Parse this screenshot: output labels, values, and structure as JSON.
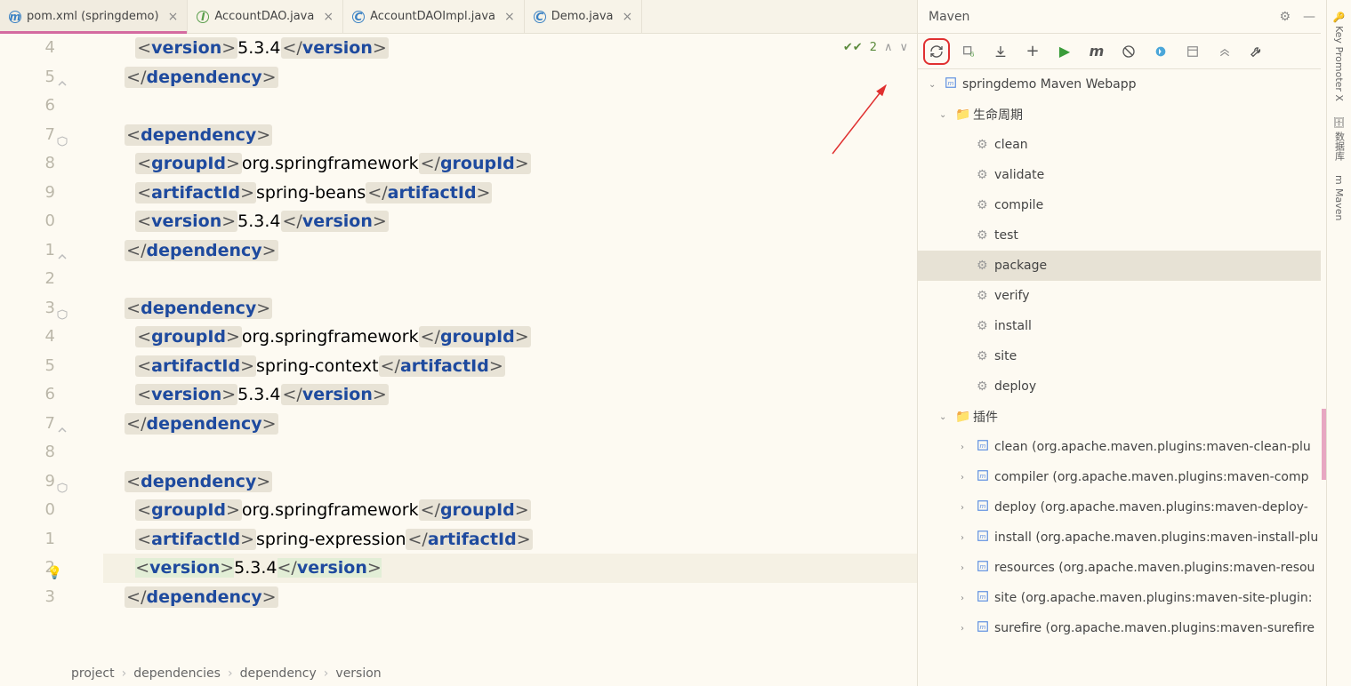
{
  "tabs": [
    {
      "label": "pom.xml (springdemo)",
      "icon": "m",
      "color": "#3b82c4",
      "active": true
    },
    {
      "label": "AccountDAO.java",
      "icon": "I",
      "color": "#5a9e4c"
    },
    {
      "label": "AccountDAOImpl.java",
      "icon": "C",
      "color": "#3b82c4"
    },
    {
      "label": "Demo.java",
      "icon": "C",
      "color": "#3b82c4"
    }
  ],
  "gutter_start": 4,
  "code": {
    "l4": {
      "ind": 3,
      "open": "version",
      "text": "5.3.4",
      "close": "version"
    },
    "l5": {
      "ind": 2,
      "close_only": "dependency"
    },
    "l7": {
      "ind": 2,
      "open_only": "dependency"
    },
    "l8": {
      "ind": 3,
      "open": "groupId",
      "text": "org.springframework",
      "close": "groupId"
    },
    "l9": {
      "ind": 3,
      "open": "artifactId",
      "text": "spring-beans",
      "close": "artifactId"
    },
    "l10": {
      "ind": 3,
      "open": "version",
      "text": "5.3.4",
      "close": "version"
    },
    "l11": {
      "ind": 2,
      "close_only": "dependency"
    },
    "l13": {
      "ind": 2,
      "open_only": "dependency"
    },
    "l14": {
      "ind": 3,
      "open": "groupId",
      "text": "org.springframework",
      "close": "groupId"
    },
    "l15": {
      "ind": 3,
      "open": "artifactId",
      "text": "spring-context",
      "close": "artifactId"
    },
    "l16": {
      "ind": 3,
      "open": "version",
      "text": "5.3.4",
      "close": "version"
    },
    "l17": {
      "ind": 2,
      "close_only": "dependency"
    },
    "l19": {
      "ind": 2,
      "open_only": "dependency"
    },
    "l20": {
      "ind": 3,
      "open": "groupId",
      "text": "org.springframework",
      "close": "groupId"
    },
    "l21": {
      "ind": 3,
      "open": "artifactId",
      "text": "spring-expression",
      "close": "artifactId"
    },
    "l22": {
      "ind": 3,
      "open": "version",
      "text": "5.3.4",
      "close": "version",
      "hl": true
    },
    "l23": {
      "ind": 2,
      "close_only": "dependency"
    }
  },
  "inspections": {
    "count": "2"
  },
  "breadcrumb": [
    "project",
    "dependencies",
    "dependency",
    "version"
  ],
  "maven": {
    "title": "Maven",
    "root": "springdemo Maven Webapp",
    "lifecycle_label": "生命周期",
    "plugins_label": "插件",
    "lifecycle": [
      "clean",
      "validate",
      "compile",
      "test",
      "package",
      "verify",
      "install",
      "site",
      "deploy"
    ],
    "lifecycle_selected": 4,
    "plugins": [
      "clean (org.apache.maven.plugins:maven-clean-plu",
      "compiler (org.apache.maven.plugins:maven-comp",
      "deploy (org.apache.maven.plugins:maven-deploy-",
      "install (org.apache.maven.plugins:maven-install-plu",
      "resources (org.apache.maven.plugins:maven-resou",
      "site (org.apache.maven.plugins:maven-site-plugin:",
      "surefire (org.apache.maven.plugins:maven-surefire"
    ]
  },
  "sidetabs": [
    "Key Promoter X",
    "数据库",
    "Maven"
  ]
}
